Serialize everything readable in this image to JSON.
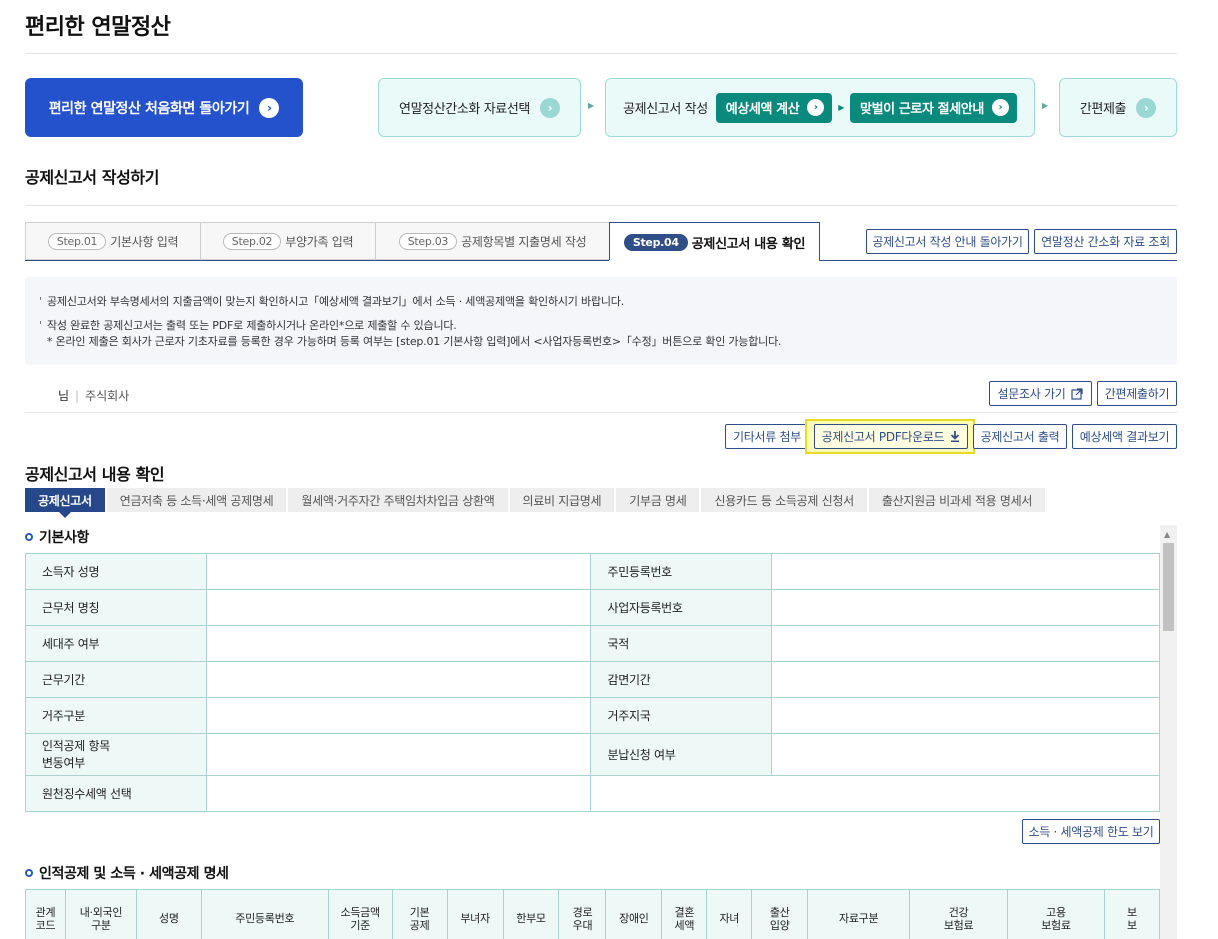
{
  "page_title": "편리한 연말정산",
  "process": {
    "home_label": "편리한 연말정산 처음화면 돌아가기",
    "step1_label": "연말정산간소화 자료선택",
    "step2_label": "공제신고서 작성",
    "step2_pill1": "예상세액 계산",
    "step2_pill2": "맞벌이 근로자 절세안내",
    "step3_label": "간편제출"
  },
  "section_title": "공제신고서 작성하기",
  "steps": [
    {
      "badge": "Step.01",
      "label": "기본사항 입력"
    },
    {
      "badge": "Step.02",
      "label": "부양가족 입력"
    },
    {
      "badge": "Step.03",
      "label": "공제항목별 지출명세 작성"
    },
    {
      "badge": "Step.04",
      "label": "공제신고서 내용 확인"
    }
  ],
  "step_buttons": {
    "guide_back": "공제신고서 작성 안내 돌아가기",
    "simplify_lookup": "연말정산 간소화 자료 조회"
  },
  "notice": {
    "line1": "공제신고서와 부속명세서의 지출금액이 맞는지 확인하시고「예상세액 결과보기」에서 소득 · 세액공제액을 확인하시기 바랍니다.",
    "line2": "작성 완료한 공제신고서는 출력 또는 PDF로 제출하시거나 온라인*으로 제출할 수 있습니다.",
    "line3": "* 온라인 제출은 회사가 근로자 기초자료를 등록한 경우 가능하며 등록 여부는 [step.01 기본사항 입력]에서 <사업자등록번호>「수정」버튼으로 확인 가능합니다."
  },
  "user": {
    "suffix": "님",
    "company": "주식회사"
  },
  "user_buttons": {
    "survey": "설문조사 가기",
    "quick_submit": "간편제출하기"
  },
  "actions": {
    "attach": "기타서류 첨부",
    "pdf": "공제신고서 PDF다운로드",
    "print": "공제신고서 출력",
    "result": "예상세액 결과보기"
  },
  "content_title": "공제신고서 내용 확인",
  "doc_tabs": [
    "공제신고서",
    "연금저축 등 소득·세액 공제명세",
    "월세액·거주자간 주택임차차입금 상환액",
    "의료비 지급명세",
    "기부금 명세",
    "신용카드 등 소득공제 신청서",
    "출산지원금 비과세 적용 명세서"
  ],
  "basic": {
    "title": "기본사항",
    "rows": [
      {
        "left": "소득자 성명",
        "right": "주민등록번호"
      },
      {
        "left": "근무처 명칭",
        "right": "사업자등록번호"
      },
      {
        "left": "세대주 여부",
        "right": "국적"
      },
      {
        "left": "근무기간",
        "right": "감면기간"
      },
      {
        "left": "거주구분",
        "right": "거주지국"
      },
      {
        "left": "인적공제 항목",
        "left2": "변동여부",
        "right": "분납신청 여부"
      },
      {
        "left": "원천징수세액 선택"
      }
    ],
    "limit_btn": "소득 · 세액공제 한도 보기"
  },
  "deduction": {
    "title": "인적공제 및 소득 · 세액공제 명세",
    "headers": [
      {
        "l1": "관계",
        "l2": "코드"
      },
      {
        "l1": "내·외국인",
        "l2": "구분"
      },
      {
        "l1": "성명",
        "l2": ""
      },
      {
        "l1": "주민등록번호",
        "l2": ""
      },
      {
        "l1": "소득금액",
        "l2": "기준"
      },
      {
        "l1": "기본",
        "l2": "공제"
      },
      {
        "l1": "부녀자",
        "l2": ""
      },
      {
        "l1": "한부모",
        "l2": ""
      },
      {
        "l1": "경로",
        "l2": "우대"
      },
      {
        "l1": "장애인",
        "l2": ""
      },
      {
        "l1": "결혼",
        "l2": "세액"
      },
      {
        "l1": "자녀",
        "l2": ""
      },
      {
        "l1": "출산",
        "l2": "입양"
      },
      {
        "l1": "자료구분",
        "l2": ""
      },
      {
        "l1": "건강",
        "l2": "보험료"
      },
      {
        "l1": "고용",
        "l2": "보험료"
      },
      {
        "l1": "보",
        "l2": "보"
      }
    ]
  }
}
